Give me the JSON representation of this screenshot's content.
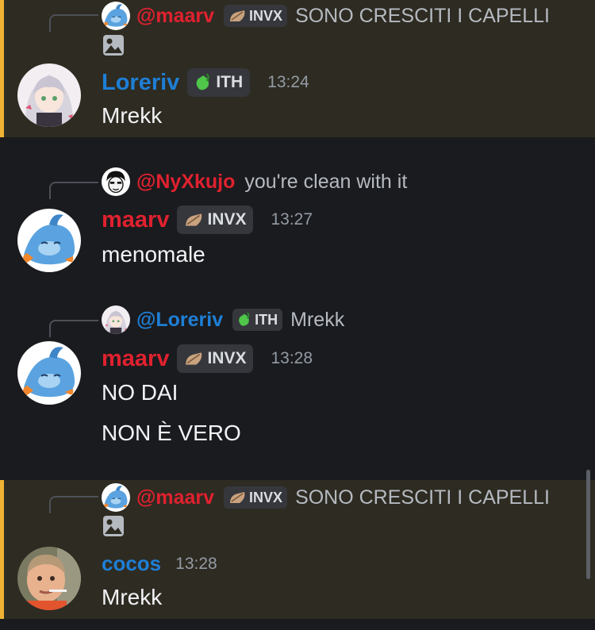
{
  "messages": [
    {
      "reply": {
        "name": "@maarv",
        "tag": "INVX",
        "text": "SONO CRESCITI I CAPELLI",
        "attachment_icon": "image-icon"
      },
      "author": "Loreriv",
      "tag": "ITH",
      "time": "13:24",
      "lines": [
        "Mrekk"
      ]
    },
    {
      "reply": {
        "name": "@NyXkujo",
        "text": "you're clean with it"
      },
      "author": "maarv",
      "tag": "INVX",
      "time": "13:27",
      "lines": [
        "menomale"
      ]
    },
    {
      "reply": {
        "name": "@Loreriv",
        "tag": "ITH",
        "text": "Mrekk"
      },
      "author": "maarv",
      "tag": "INVX",
      "time": "13:28",
      "lines": [
        "NO DAI",
        "NON È VERO"
      ]
    },
    {
      "reply": {
        "name": "@maarv",
        "tag": "INVX",
        "text": "SONO CRESCITI I CAPELLI",
        "attachment_icon": "image-icon"
      },
      "author": "cocos",
      "time": "13:28",
      "lines": [
        "Mrekk"
      ]
    }
  ],
  "colors": {
    "mention_highlight": "#2e2b22",
    "mention_bar": "#f0b232",
    "red_name": "#e0212f",
    "blue_name": "#1e7fd6"
  }
}
